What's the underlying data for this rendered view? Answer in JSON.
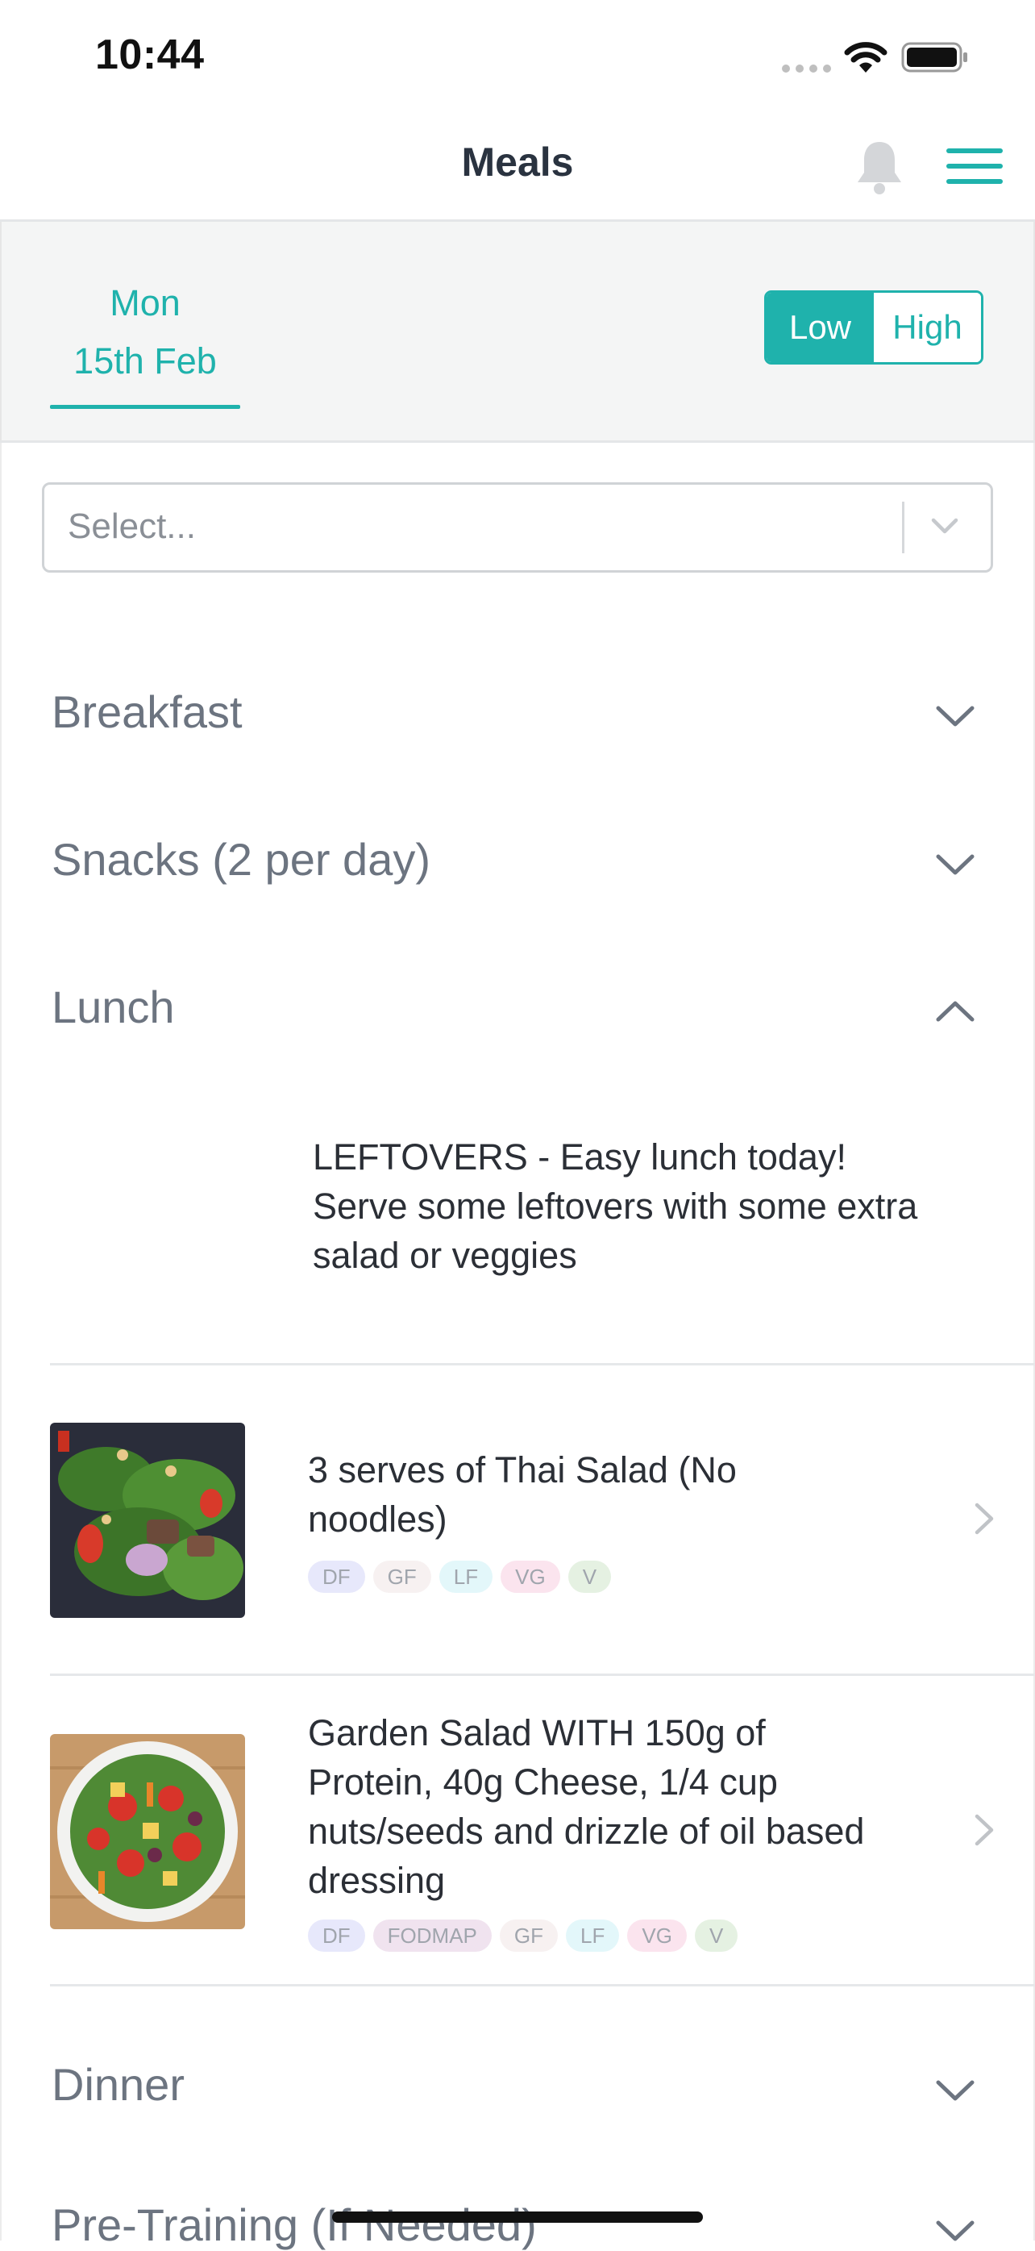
{
  "status_bar": {
    "time": "10:44"
  },
  "header": {
    "title": "Meals"
  },
  "day_tab": {
    "weekday": "Mon",
    "date": "15th Feb"
  },
  "intensity_toggle": {
    "low_label": "Low",
    "high_label": "High",
    "selected": "Low"
  },
  "select": {
    "placeholder": "Select..."
  },
  "sections": {
    "breakfast": "Breakfast",
    "snacks": "Snacks (2 per day)",
    "lunch": "Lunch",
    "dinner": "Dinner",
    "pre_training": "Pre-Training (If Needed)"
  },
  "lunch": {
    "note": "LEFTOVERS - Easy lunch today! Serve some leftovers with some extra salad or veggies",
    "meals": [
      {
        "title": "3 serves of Thai Salad (No noodles)",
        "tags": [
          "DF",
          "GF",
          "LF",
          "VG",
          "V"
        ]
      },
      {
        "title": "Garden Salad WITH 150g of Protein, 40g Cheese, 1/4 cup nuts/seeds and drizzle of oil based dressing",
        "tags": [
          "DF",
          "FODMAP",
          "GF",
          "LF",
          "VG",
          "V"
        ]
      }
    ]
  },
  "tag_colors": {
    "DF": "#e7e8fb",
    "GF": "#f7f1f1",
    "LF": "#e3f7fa",
    "VG": "#fbe4ee",
    "V": "#e5f1e2",
    "FODMAP": "#f0e3ef"
  },
  "colors": {
    "accent": "#1fb2ac"
  }
}
